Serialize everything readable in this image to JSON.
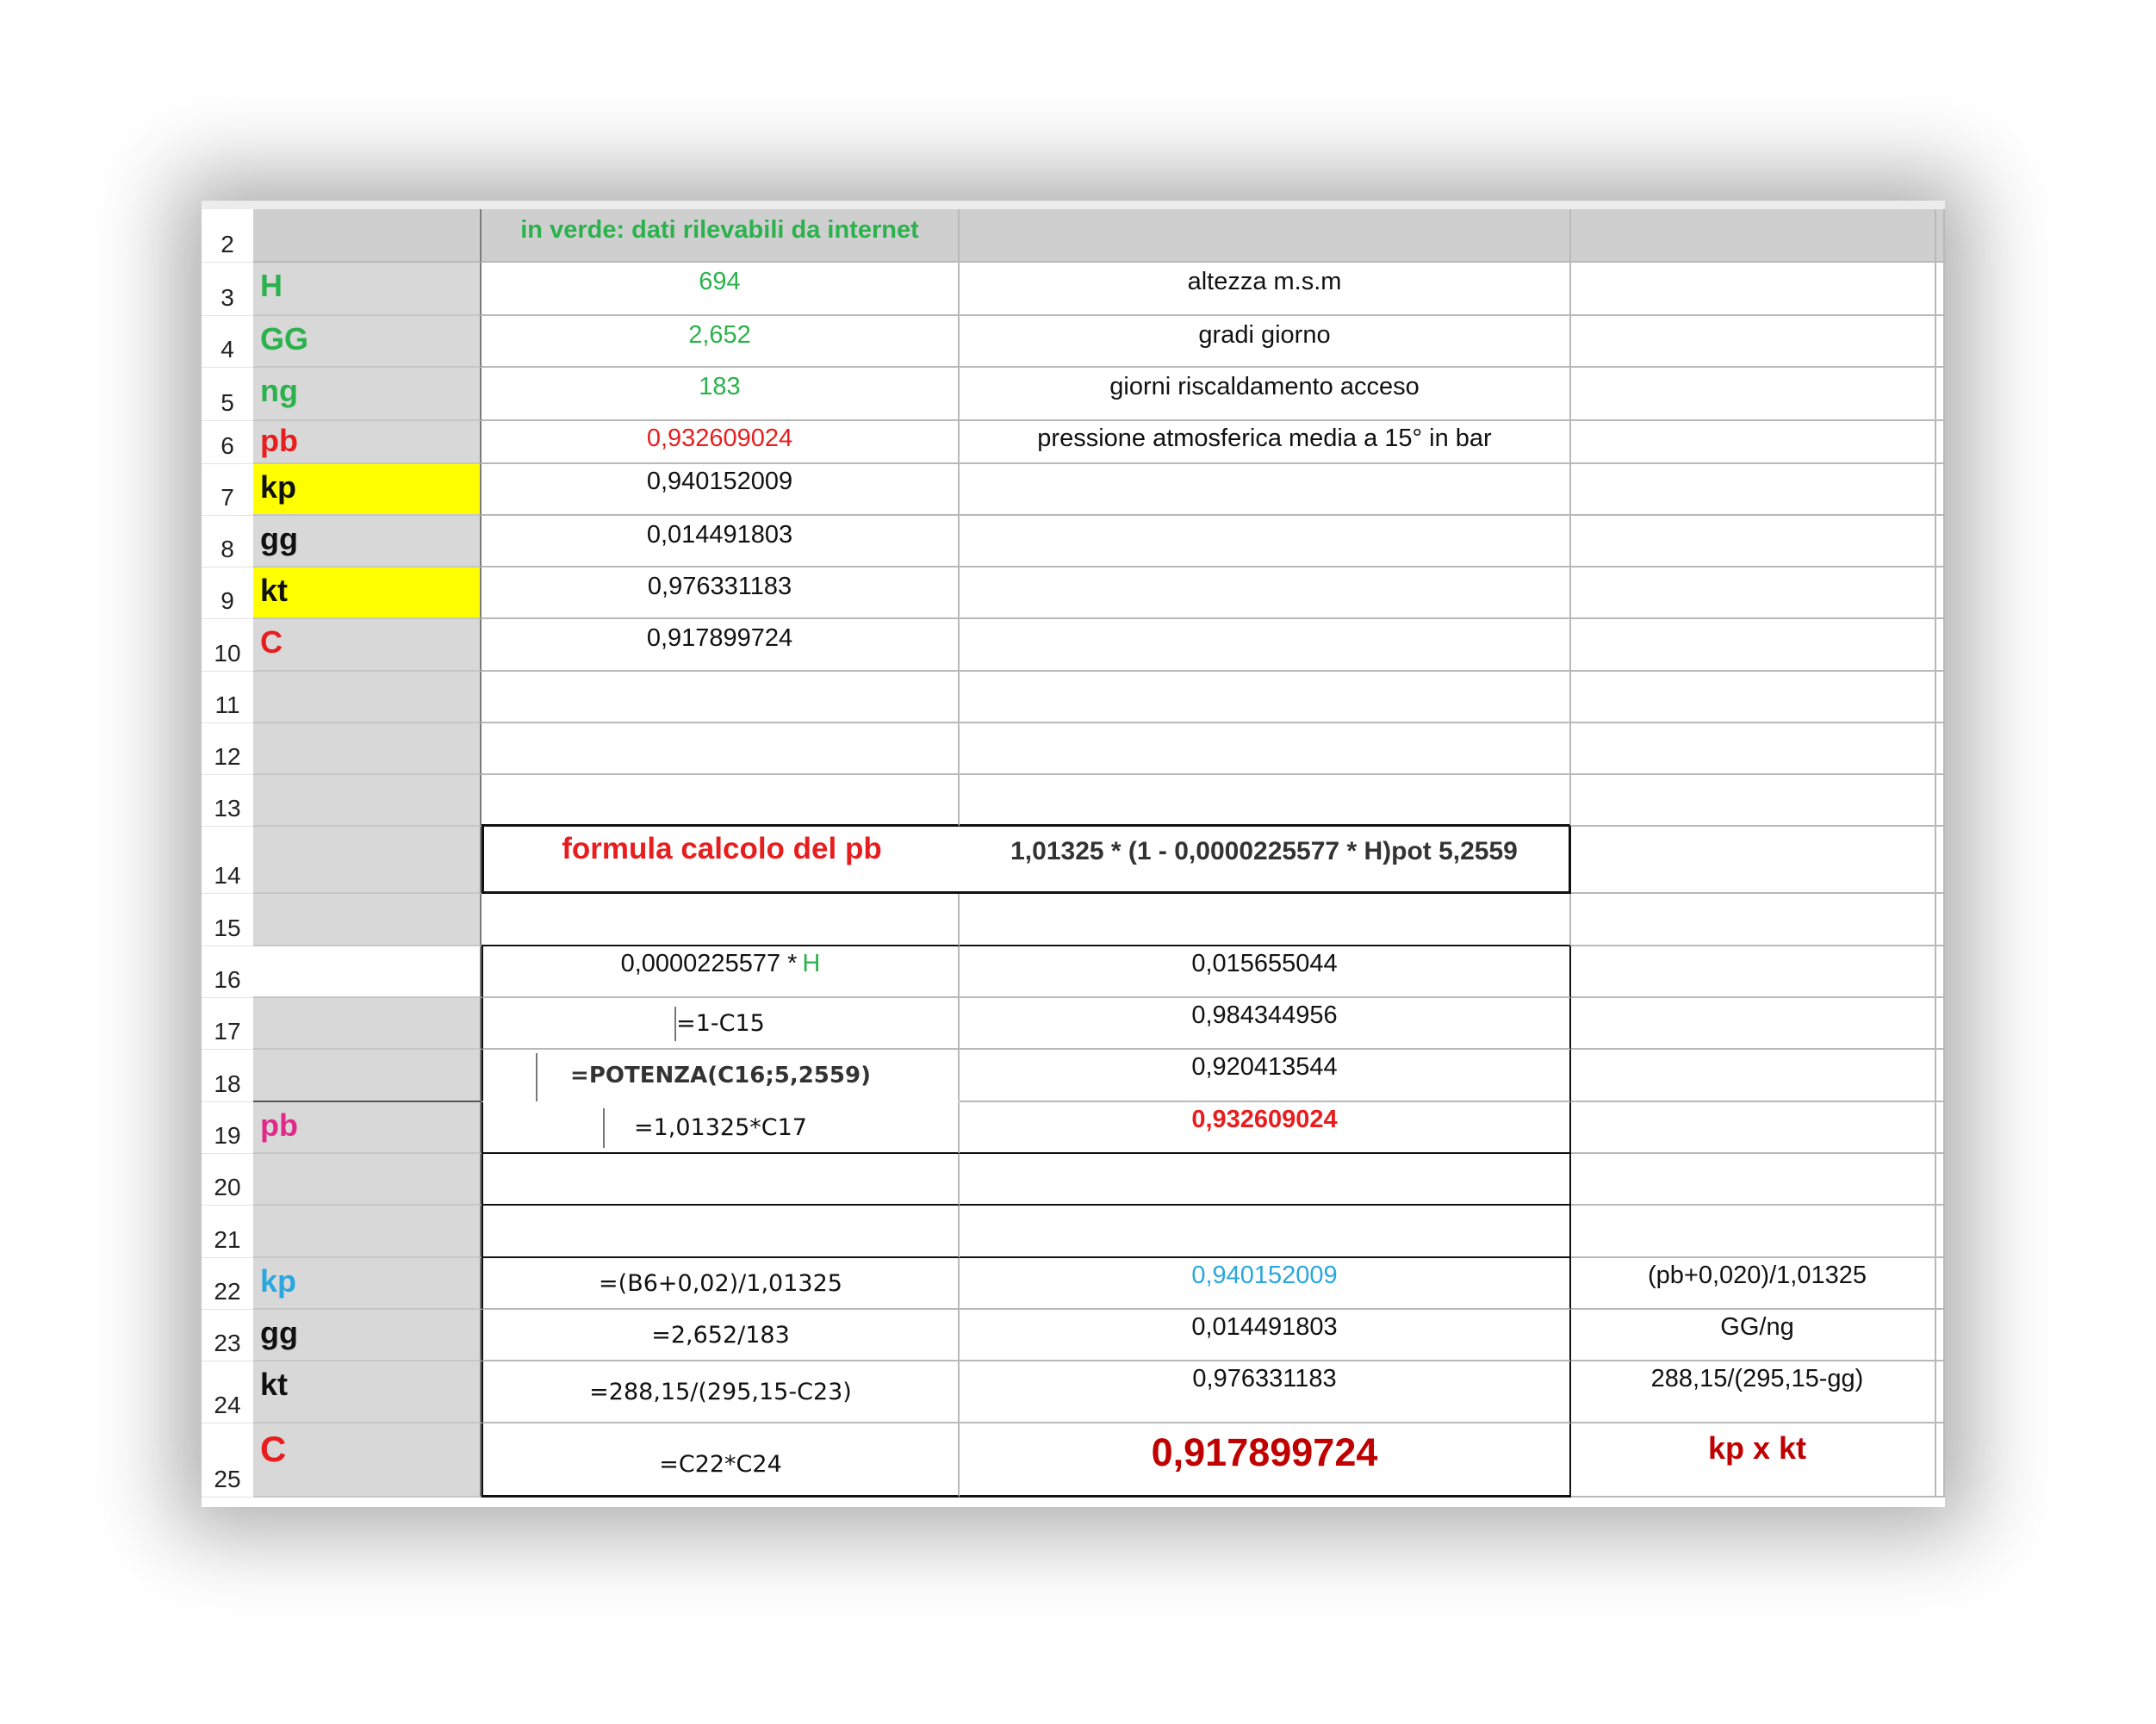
{
  "sheet": {
    "row_numbers": [
      "2",
      "3",
      "4",
      "5",
      "6",
      "7",
      "8",
      "9",
      "10",
      "11",
      "12",
      "13",
      "14",
      "15",
      "16",
      "17",
      "18",
      "19",
      "20",
      "21",
      "22",
      "23",
      "24",
      "25"
    ],
    "header_note": "in verde: dati rilevabili da internet",
    "labels": {
      "r3": "H",
      "r4": "GG",
      "r5": "ng",
      "r6": "pb",
      "r7": "kp",
      "r8": "gg",
      "r9": "kt",
      "r10": "C",
      "r19": "pb",
      "r22": "kp",
      "r23": "gg",
      "r24": "kt",
      "r25": "C"
    },
    "values": {
      "r3": "694",
      "r4": "2,652",
      "r5": "183",
      "r6": "0,932609024",
      "r7": "0,940152009",
      "r8": "0,014491803",
      "r9": "0,976331183",
      "r10": "0,917899724"
    },
    "descriptions": {
      "r3": "altezza m.s.m",
      "r4": "gradi giorno",
      "r5": "giorni riscaldamento acceso",
      "r6": "pressione atmosferica media a 15° in bar"
    },
    "formula_box": {
      "label": "formula calcolo del pb",
      "formula": "1,01325 * (1 - 0,0000225577 * H)pot 5,2559"
    },
    "calc": {
      "r16_expr": "0,0000225577 * ",
      "r16_expr_var": "H",
      "r16_val": "0,015655044",
      "r17_expr": "=1-C15",
      "r17_val": "0,984344956",
      "r18_expr": "=POTENZA(C16;5,2559)",
      "r18_val": "0,920413544",
      "r19_expr": "=1,01325*C17",
      "r19_val": "0,932609024",
      "r22_expr": "=(B6+0,02)/1,01325",
      "r22_val": "0,940152009",
      "r22_note": "(pb+0,020)/1,01325",
      "r23_expr": "=2,652/183",
      "r23_val": "0,014491803",
      "r23_note": "GG/ng",
      "r24_expr": "=288,15/(295,15-C23)",
      "r24_val": "0,976331183",
      "r24_note": "288,15/(295,15-gg)",
      "r25_expr": "=C22*C24",
      "r25_val": "0,917899724",
      "r25_note": "kp x kt"
    },
    "colors": {
      "green": "#2bb24c",
      "red": "#e81e1e",
      "dark_red": "#c00000",
      "blue": "#2aa7e0",
      "pink": "#e02a8a",
      "highlight_yellow": "#ffff00",
      "label_gray": "#d8d8d8"
    }
  }
}
